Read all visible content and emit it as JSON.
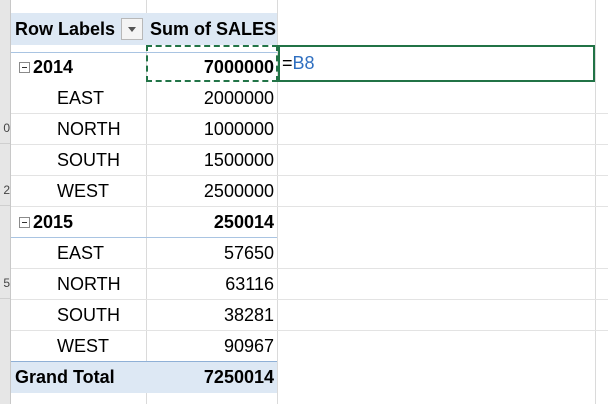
{
  "row_numbers": [
    "",
    "",
    "",
    "0",
    "",
    "2",
    "",
    "",
    "5",
    "",
    "",
    ""
  ],
  "pivot": {
    "header_row_labels": "Row Labels",
    "header_sum": "Sum of SALES",
    "year1": {
      "label": "2014",
      "total": "7000000",
      "rows": [
        {
          "region": "EAST",
          "value": "2000000"
        },
        {
          "region": "NORTH",
          "value": "1000000"
        },
        {
          "region": "SOUTH",
          "value": "1500000"
        },
        {
          "region": "WEST",
          "value": "2500000"
        }
      ]
    },
    "year2": {
      "label": "2015",
      "total": "250014",
      "rows": [
        {
          "region": "EAST",
          "value": "57650"
        },
        {
          "region": "NORTH",
          "value": "63116"
        },
        {
          "region": "SOUTH",
          "value": "38281"
        },
        {
          "region": "WEST",
          "value": "90967"
        }
      ]
    },
    "grand_total_label": "Grand Total",
    "grand_total_value": "7250014"
  },
  "formula_edit": {
    "equals": "=",
    "reference": "B8"
  },
  "colors": {
    "header_fill": "#dde8f4",
    "selection_border": "#217346",
    "reference_text": "#2f6fc0"
  }
}
